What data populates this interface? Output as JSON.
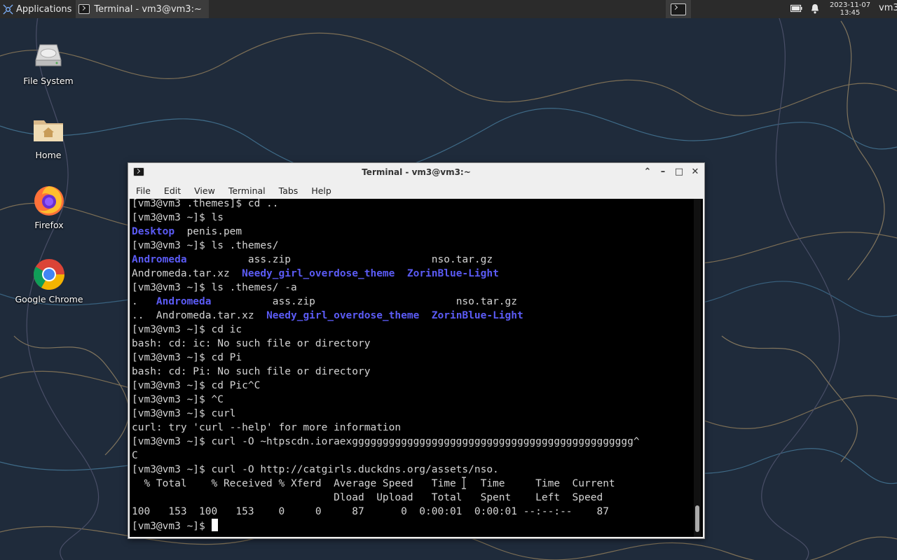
{
  "panel": {
    "applications_label": "Applications",
    "task_title": "Terminal - vm3@vm3:~",
    "clock_date": "2023-11-07",
    "clock_time": "13:45",
    "user": "vm3"
  },
  "desktop_icons": [
    {
      "label": "File System",
      "icon": "drive-icon"
    },
    {
      "label": "Home",
      "icon": "home-folder-icon"
    },
    {
      "label": "Firefox",
      "icon": "firefox-icon"
    },
    {
      "label": "Google Chrome",
      "icon": "chrome-icon"
    }
  ],
  "window": {
    "title": "Terminal - vm3@vm3:~",
    "menu": [
      "File",
      "Edit",
      "View",
      "Terminal",
      "Tabs",
      "Help"
    ]
  },
  "terminal": {
    "lines": [
      [
        {
          "t": "[vm3@vm3 .themes]$ cd .."
        }
      ],
      [
        {
          "t": "[vm3@vm3 ~]$ ls"
        }
      ],
      [
        {
          "t": "Desktop",
          "c": "blue"
        },
        {
          "t": "  penis.pem"
        }
      ],
      [
        {
          "t": "[vm3@vm3 ~]$ ls .themes/"
        }
      ],
      [
        {
          "t": "Andromeda",
          "c": "blue"
        },
        {
          "t": "          ass.zip                       nso.tar.gz"
        }
      ],
      [
        {
          "t": "Andromeda.tar.xz  "
        },
        {
          "t": "Needy_girl_overdose_theme",
          "c": "blue"
        },
        {
          "t": "  "
        },
        {
          "t": "ZorinBlue-Light",
          "c": "blue"
        }
      ],
      [
        {
          "t": "[vm3@vm3 ~]$ ls .themes/ -a"
        }
      ],
      [
        {
          "t": ".   "
        },
        {
          "t": "Andromeda",
          "c": "blue"
        },
        {
          "t": "          ass.zip                       nso.tar.gz"
        }
      ],
      [
        {
          "t": "..  Andromeda.tar.xz  "
        },
        {
          "t": "Needy_girl_overdose_theme",
          "c": "blue"
        },
        {
          "t": "  "
        },
        {
          "t": "ZorinBlue-Light",
          "c": "blue"
        }
      ],
      [
        {
          "t": "[vm3@vm3 ~]$ cd ic"
        }
      ],
      [
        {
          "t": "bash: cd: ic: No such file or directory"
        }
      ],
      [
        {
          "t": "[vm3@vm3 ~]$ cd Pi"
        }
      ],
      [
        {
          "t": "bash: cd: Pi: No such file or directory"
        }
      ],
      [
        {
          "t": "[vm3@vm3 ~]$ cd Pic^C"
        }
      ],
      [
        {
          "t": "[vm3@vm3 ~]$ ^C"
        }
      ],
      [
        {
          "t": "[vm3@vm3 ~]$ curl"
        }
      ],
      [
        {
          "t": "curl: try 'curl --help' for more information"
        }
      ],
      [
        {
          "t": "[vm3@vm3 ~]$ curl -O ~htpscdn.ioraexgggggggggggggggggggggggggggggggggggggggggggggg^"
        }
      ],
      [
        {
          "t": "C"
        }
      ],
      [
        {
          "t": "[vm3@vm3 ~]$ curl -O http://catgirls.duckdns.org/assets/nso."
        }
      ],
      [
        {
          "t": "  % Total    % Received % Xferd  Average Speed   Time    Time     Time  Current"
        }
      ],
      [
        {
          "t": "                                 Dload  Upload   Total   Spent    Left  Speed"
        }
      ],
      [
        {
          "t": "100   153  100   153    0     0     87      0  0:00:01  0:00:01 --:--:--    87"
        }
      ],
      [
        {
          "t": "[vm3@vm3 ~]$ "
        }
      ]
    ]
  },
  "colors": {
    "panel_bg": "#2b2b2b",
    "terminal_bg": "#000000",
    "directory_blue": "#5b5bf5"
  }
}
